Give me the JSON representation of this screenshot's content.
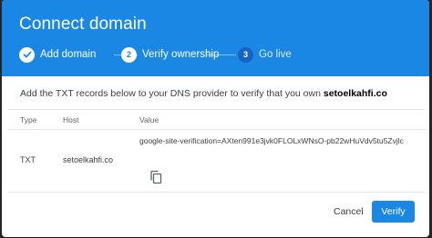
{
  "dialog": {
    "title": "Connect domain",
    "steps": [
      {
        "number": "1",
        "label": "Add domain",
        "state": "done",
        "icon": "check-icon"
      },
      {
        "number": "2",
        "label": "Verify ownership",
        "state": "active"
      },
      {
        "number": "3",
        "label": "Go live",
        "state": "pending"
      }
    ],
    "description_prefix": "Add the TXT records below to your DNS provider to verify that you own ",
    "domain": "setoelkahfi.co",
    "table": {
      "headers": [
        "Type",
        "Host",
        "Value"
      ],
      "rows": [
        {
          "type": "TXT",
          "host": "setoelkahfi.co",
          "value": "google-site-verification=AXten991e3jvk0FLOLxWNsO-pb22wHuVdv5tu5Zvjlc",
          "action_icon": "copy-icon"
        }
      ]
    },
    "buttons": {
      "cancel": "Cancel",
      "verify": "Verify"
    }
  },
  "colors": {
    "accent": "#1a87e4",
    "backdrop": "#2b2b2b"
  }
}
